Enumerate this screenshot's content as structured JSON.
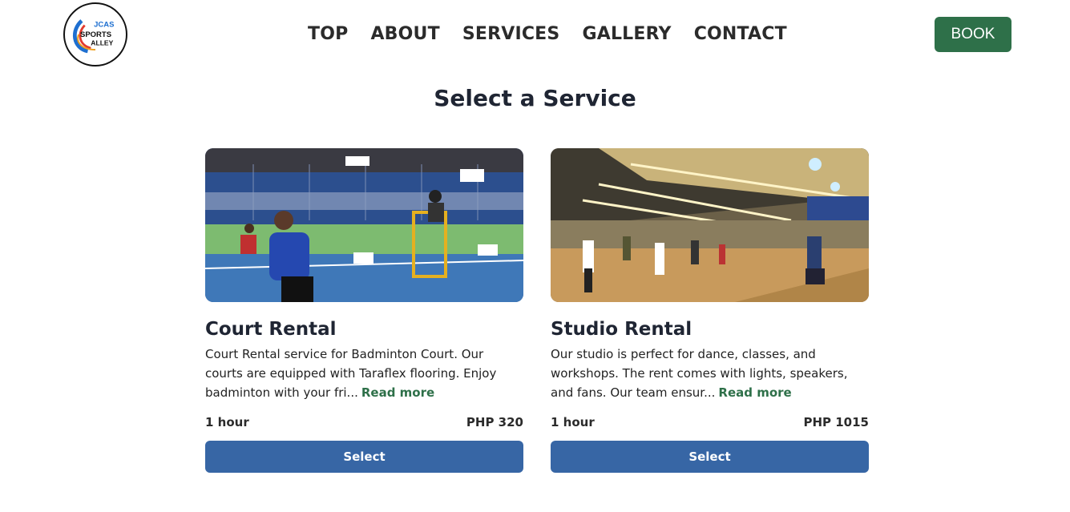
{
  "header": {
    "logo": {
      "line1": "JCAS",
      "line2": "SPORTS",
      "line3": "ALLEY"
    },
    "nav": [
      "TOP",
      "ABOUT",
      "SERVICES",
      "GALLERY",
      "CONTACT"
    ],
    "book_label": "BOOK"
  },
  "page": {
    "title": "Select a Service"
  },
  "services": [
    {
      "title": "Court Rental",
      "description": "Court Rental service for Badminton Court. Our courts are equipped with Taraflex flooring. Enjoy badminton with your fri...",
      "read_more": "Read more",
      "duration": "1 hour",
      "price": "PHP 320",
      "select_label": "Select"
    },
    {
      "title": "Studio Rental",
      "description": "Our studio is perfect for dance, classes, and workshops. The rent comes with lights, speakers, and fans. Our team ensur...",
      "read_more": "Read more",
      "duration": "1 hour",
      "price": "PHP 1015",
      "select_label": "Select"
    }
  ],
  "colors": {
    "brand_green": "#2e7049",
    "select_blue": "#3766a5",
    "text_dark": "#1f2533"
  }
}
